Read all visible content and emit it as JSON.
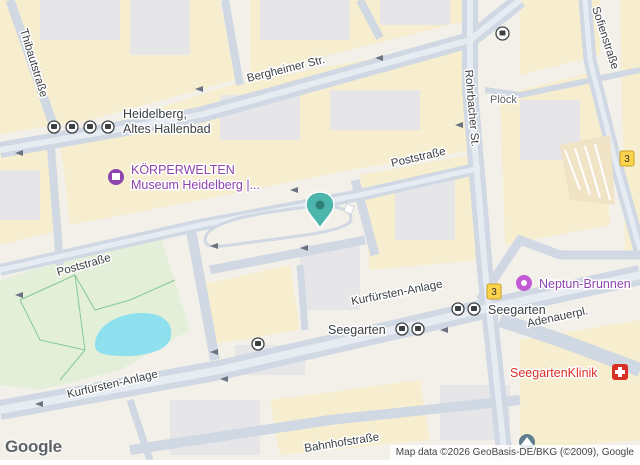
{
  "map": {
    "streets": {
      "thibaut": "Thibautstraße",
      "bergheimer": "Bergheimer Str.",
      "rohrbacher": "Rohrbacher St.",
      "sofien": "Sofienstraße",
      "ploeck": "Plöck",
      "post_north": "Poststraße",
      "post_west": "Poststraße",
      "kurfuersten_east": "Kurfürsten-Anlage",
      "kurfuersten_west": "Kurfürsten-Anlage",
      "adenauer": "Adenauerpl.",
      "bahnhof": "Bahnhofstraße"
    },
    "route_badges": [
      "3",
      "3"
    ],
    "transit": {
      "altes_hallenbad": "Heidelberg,",
      "altes_hallenbad_line2": "Altes Hallenbad",
      "seegarten_center": "Seegarten",
      "seegarten_east": "Seegarten"
    },
    "pois": {
      "koerperwelten_line1": "KÖRPERWELTEN",
      "koerperwelten_line2": "Museum Heidelberg |...",
      "neptun": "Neptun-Brunnen",
      "seegarten_klinik": "SeegartenKlinik"
    },
    "colors": {
      "road": "#d6dde8",
      "road_major": "#c9d3e0",
      "block": "#f6eecf",
      "building": "#e8e8ea",
      "water": "#8ee0ef",
      "park": "#e6f1dd",
      "museum_purple": "#8e44ad",
      "hospital_red": "#d93025",
      "marker_teal": "#4db6ac",
      "badge_yellow": "#fcd34d"
    }
  },
  "attribution": {
    "logo": "Google",
    "text": "Map data ©2026 GeoBasis-DE/BKG (©2009), Google"
  }
}
